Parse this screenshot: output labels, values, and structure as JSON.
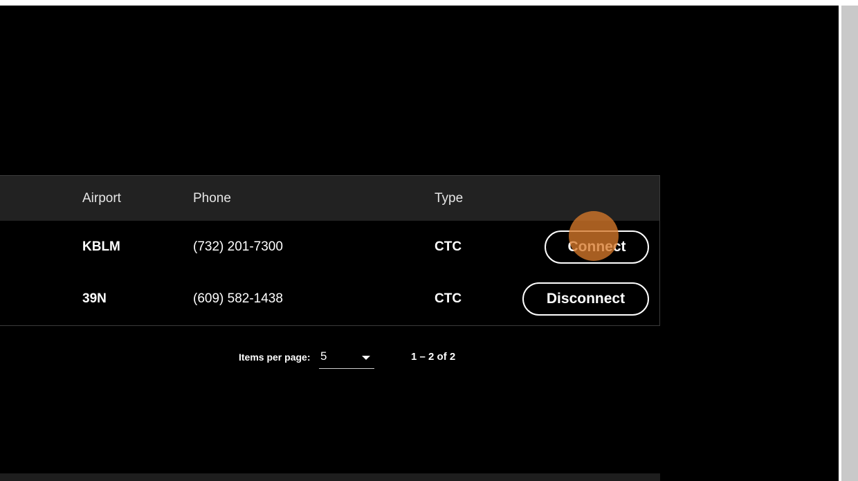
{
  "table": {
    "headers": {
      "airport": "Airport",
      "phone": "Phone",
      "type": "Type"
    },
    "rows": [
      {
        "airport": "KBLM",
        "phone": "(732) 201-7300",
        "type": "CTC",
        "action": "Connect"
      },
      {
        "airport": "39N",
        "phone": "(609) 582-1438",
        "type": "CTC",
        "action": "Disconnect"
      }
    ]
  },
  "paginator": {
    "items_per_page_label": "Items per page:",
    "items_per_page_value": "5",
    "range_label": "1 – 2 of 2"
  },
  "colors": {
    "background": "#000000",
    "header_background": "#222222",
    "click_marker": "#d6782a",
    "scrollbar": "#c9c9c9"
  }
}
